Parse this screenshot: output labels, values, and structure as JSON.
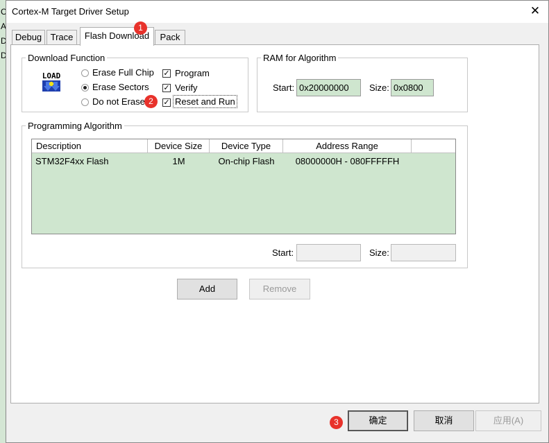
{
  "window": {
    "title": "Cortex-M Target Driver Setup",
    "close_glyph": "✕"
  },
  "background_letters": [
    "C",
    "A",
    "D"
  ],
  "tabs": [
    {
      "label": "Debug"
    },
    {
      "label": "Trace"
    },
    {
      "label": "Flash Download",
      "active": true
    },
    {
      "label": "Pack"
    }
  ],
  "download_function": {
    "title": "Download Function",
    "icon": "load-icon",
    "icon_text": "LOAD",
    "radios": [
      {
        "label": "Erase Full Chip",
        "checked": false
      },
      {
        "label": "Erase Sectors",
        "checked": true
      },
      {
        "label": "Do not Erase",
        "checked": false
      }
    ],
    "checks": [
      {
        "label": "Program",
        "checked": true
      },
      {
        "label": "Verify",
        "checked": true
      },
      {
        "label": "Reset and Run",
        "checked": true
      }
    ]
  },
  "ram": {
    "title": "RAM for Algorithm",
    "start_label": "Start:",
    "start_value": "0x20000000",
    "size_label": "Size:",
    "size_value": "0x0800"
  },
  "programming": {
    "title": "Programming Algorithm",
    "columns": [
      "Description",
      "Device Size",
      "Device Type",
      "Address Range"
    ],
    "rows": [
      {
        "description": "STM32F4xx Flash",
        "size": "1M",
        "type": "On-chip Flash",
        "range": "08000000H - 080FFFFFH"
      }
    ],
    "start_label": "Start:",
    "start_value": "",
    "size_label": "Size:",
    "size_value": ""
  },
  "buttons": {
    "add": "Add",
    "remove": "Remove",
    "ok": "确定",
    "cancel": "取消",
    "apply": "应用(A)"
  },
  "badges": [
    "1",
    "2",
    "3"
  ],
  "colors": {
    "badge": "#e8322b",
    "field_green": "#cfe6cf"
  }
}
